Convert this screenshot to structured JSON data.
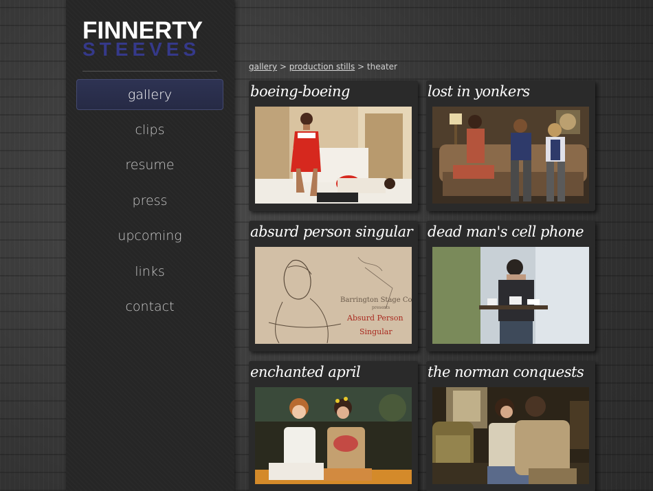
{
  "logo": {
    "top": "FINNERTY",
    "bottom": "STEEVES",
    "top_color": "#ffffff",
    "bottom_color": "#35398a"
  },
  "nav": {
    "items": [
      {
        "label": "gallery",
        "active": true
      },
      {
        "label": "clips"
      },
      {
        "label": "resume"
      },
      {
        "label": "press"
      },
      {
        "label": "upcoming"
      },
      {
        "label": "links"
      },
      {
        "label": "contact"
      }
    ]
  },
  "breadcrumb": {
    "link1": "gallery",
    "sep1": " > ",
    "link2": "production stills",
    "sep2": " > ",
    "current": "theater"
  },
  "gallery": [
    {
      "title": "boeing-boeing"
    },
    {
      "title": "lost in yonkers"
    },
    {
      "title": "absurd person singular",
      "poster_text": [
        "Barrington Stage Co.",
        "presents",
        "Absurd Person",
        "Singular"
      ]
    },
    {
      "title": "dead man's cell phone"
    },
    {
      "title": "enchanted april"
    },
    {
      "title": "the norman conquests"
    }
  ],
  "colors": {
    "accent": "#35398a",
    "active_nav_bg": "#2a2f4d"
  }
}
